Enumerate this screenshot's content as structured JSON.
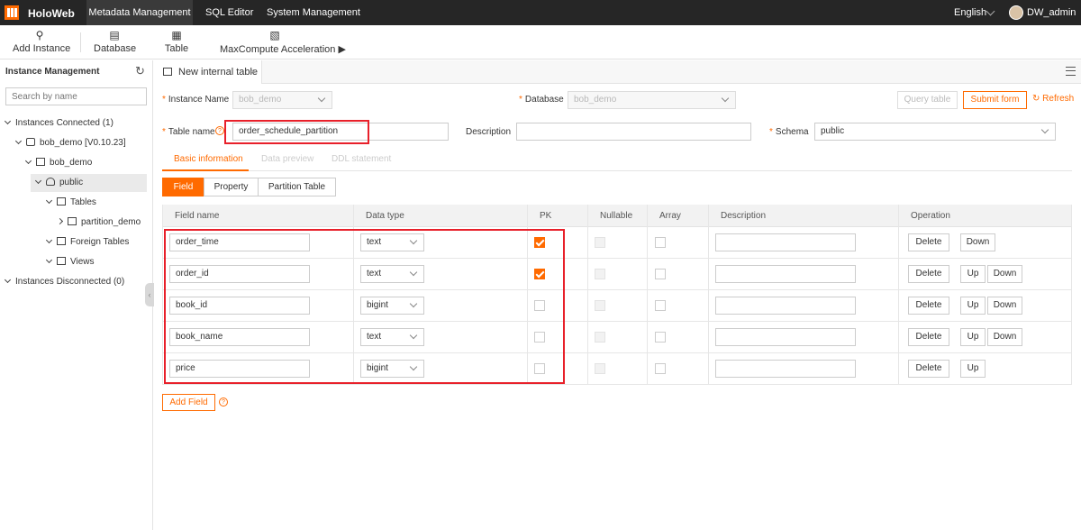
{
  "topbar": {
    "brand": "HoloWeb",
    "nav": [
      "Metadata Management",
      "SQL Editor",
      "System Management"
    ],
    "language": "English",
    "user": "DW_admin",
    "accent": "#ff6a00"
  },
  "toolbar": {
    "items": [
      {
        "label": "Add Instance",
        "icon": "plug-icon"
      },
      {
        "label": "Database",
        "icon": "database-icon"
      },
      {
        "label": "Table",
        "icon": "table-icon"
      },
      {
        "label": "MaxCompute Acceleration",
        "icon": "acceleration-icon"
      }
    ]
  },
  "sidebar": {
    "title": "Instance Management",
    "search_placeholder": "Search by name",
    "tree": {
      "connected": "Instances Connected (1)",
      "instance": "bob_demo [V0.10.23]",
      "database": "bob_demo",
      "schema": "public",
      "tables": "Tables",
      "table_item": "partition_demo",
      "foreign_tables": "Foreign Tables",
      "views": "Views",
      "disconnected": "Instances Disconnected (0)"
    }
  },
  "tab": {
    "label": "New internal table",
    "close": "×"
  },
  "form": {
    "instance_label": "Instance Name",
    "instance_value": "bob_demo",
    "database_label": "Database",
    "database_value": "bob_demo",
    "query_table": "Query table",
    "submit": "Submit form",
    "refresh": "Refresh",
    "table_name_label": "Table name",
    "table_name_value": "order_schedule_partition",
    "description_label": "Description",
    "description_value": "",
    "schema_label": "Schema",
    "schema_value": "public",
    "required_mark": "*",
    "help": "?"
  },
  "subtabs": [
    "Basic information",
    "Data preview",
    "DDL statement"
  ],
  "segments": [
    "Field",
    "Property",
    "Partition Table"
  ],
  "grid": {
    "headers": [
      "Field name",
      "Data type",
      "PK",
      "Nullable",
      "Array",
      "Description",
      "Operation"
    ],
    "rows": [
      {
        "name": "order_time",
        "type": "text",
        "pk": true,
        "nullable": false,
        "array": false,
        "ops": [
          "Delete",
          "Down"
        ]
      },
      {
        "name": "order_id",
        "type": "text",
        "pk": true,
        "nullable": false,
        "array": false,
        "ops": [
          "Delete",
          "Up",
          "Down"
        ]
      },
      {
        "name": "book_id",
        "type": "bigint",
        "pk": false,
        "nullable": false,
        "array": false,
        "ops": [
          "Delete",
          "Up",
          "Down"
        ]
      },
      {
        "name": "book_name",
        "type": "text",
        "pk": false,
        "nullable": false,
        "array": false,
        "ops": [
          "Delete",
          "Up",
          "Down"
        ]
      },
      {
        "name": "price",
        "type": "bigint",
        "pk": false,
        "nullable": false,
        "array": false,
        "ops": [
          "Delete",
          "Up"
        ]
      }
    ],
    "add_field": "Add Field"
  }
}
